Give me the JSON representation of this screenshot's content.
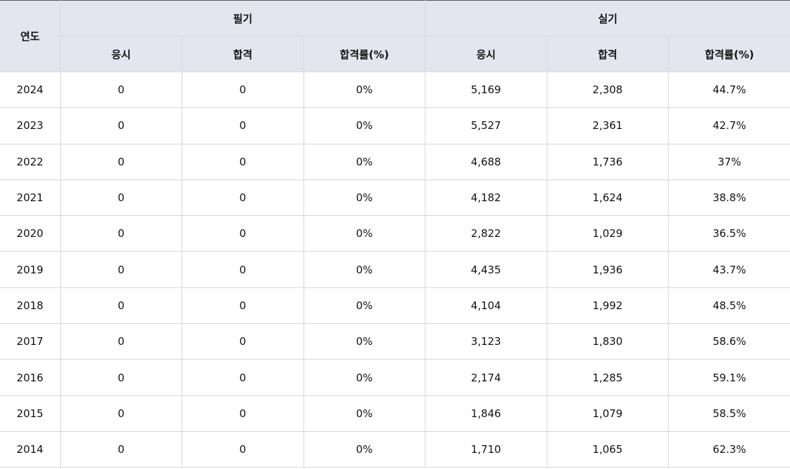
{
  "table": {
    "year_header": "연도",
    "groups": [
      {
        "label": "필기",
        "columns": [
          "응시",
          "합격",
          "합격률(%)"
        ]
      },
      {
        "label": "실기",
        "columns": [
          "응시",
          "합격",
          "합격률(%)"
        ]
      }
    ],
    "rows": [
      {
        "year": "2024",
        "written": [
          "0",
          "0",
          "0%"
        ],
        "practical": [
          "5,169",
          "2,308",
          "44.7%"
        ]
      },
      {
        "year": "2023",
        "written": [
          "0",
          "0",
          "0%"
        ],
        "practical": [
          "5,527",
          "2,361",
          "42.7%"
        ]
      },
      {
        "year": "2022",
        "written": [
          "0",
          "0",
          "0%"
        ],
        "practical": [
          "4,688",
          "1,736",
          "37%"
        ]
      },
      {
        "year": "2021",
        "written": [
          "0",
          "0",
          "0%"
        ],
        "practical": [
          "4,182",
          "1,624",
          "38.8%"
        ]
      },
      {
        "year": "2020",
        "written": [
          "0",
          "0",
          "0%"
        ],
        "practical": [
          "2,822",
          "1,029",
          "36.5%"
        ]
      },
      {
        "year": "2019",
        "written": [
          "0",
          "0",
          "0%"
        ],
        "practical": [
          "4,435",
          "1,936",
          "43.7%"
        ]
      },
      {
        "year": "2018",
        "written": [
          "0",
          "0",
          "0%"
        ],
        "practical": [
          "4,104",
          "1,992",
          "48.5%"
        ]
      },
      {
        "year": "2017",
        "written": [
          "0",
          "0",
          "0%"
        ],
        "practical": [
          "3,123",
          "1,830",
          "58.6%"
        ]
      },
      {
        "year": "2016",
        "written": [
          "0",
          "0",
          "0%"
        ],
        "practical": [
          "2,174",
          "1,285",
          "59.1%"
        ]
      },
      {
        "year": "2015",
        "written": [
          "0",
          "0",
          "0%"
        ],
        "practical": [
          "1,846",
          "1,079",
          "58.5%"
        ]
      },
      {
        "year": "2014",
        "written": [
          "0",
          "0",
          "0%"
        ],
        "practical": [
          "1,710",
          "1,065",
          "62.3%"
        ]
      }
    ]
  },
  "colors": {
    "header_background": "#e3e6ee",
    "border": "#d5d8de",
    "text": "#111111"
  }
}
